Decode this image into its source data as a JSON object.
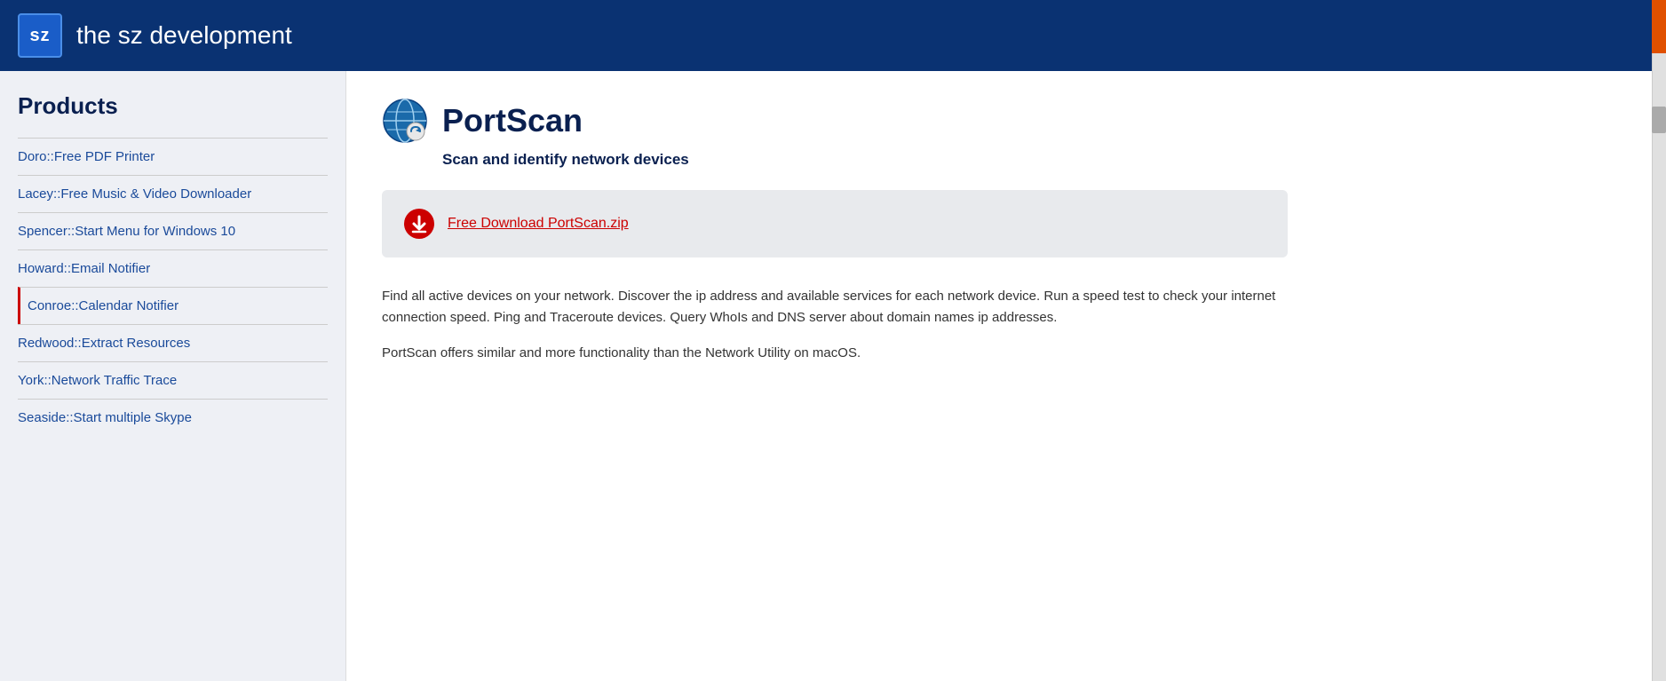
{
  "header": {
    "logo_text": "sz",
    "title": "the sz development"
  },
  "sidebar": {
    "heading": "Products",
    "items": [
      {
        "id": "doro",
        "label": "Doro::Free PDF Printer",
        "active": false
      },
      {
        "id": "lacey",
        "label": "Lacey::Free Music & Video Downloader",
        "active": false
      },
      {
        "id": "spencer",
        "label": "Spencer::Start Menu for Windows 10",
        "active": false
      },
      {
        "id": "howard",
        "label": "Howard::Email Notifier",
        "active": false
      },
      {
        "id": "conroe",
        "label": "Conroe::Calendar Notifier",
        "active": true
      },
      {
        "id": "redwood",
        "label": "Redwood::Extract Resources",
        "active": false
      },
      {
        "id": "york",
        "label": "York::Network Traffic Trace",
        "active": false
      },
      {
        "id": "seaside",
        "label": "Seaside::Start multiple Skype",
        "active": false
      }
    ]
  },
  "product": {
    "title": "PortScan",
    "subtitle": "Scan and identify network devices",
    "download_label": "Free Download PortScan.zip",
    "description1": "Find all active devices on your network. Discover the ip address and available services for each network device. Run a speed test to check your internet connection speed. Ping and Traceroute devices. Query WhoIs and DNS server about domain names ip addresses.",
    "description2": "PortScan offers similar and more functionality than the Network Utility on macOS."
  }
}
